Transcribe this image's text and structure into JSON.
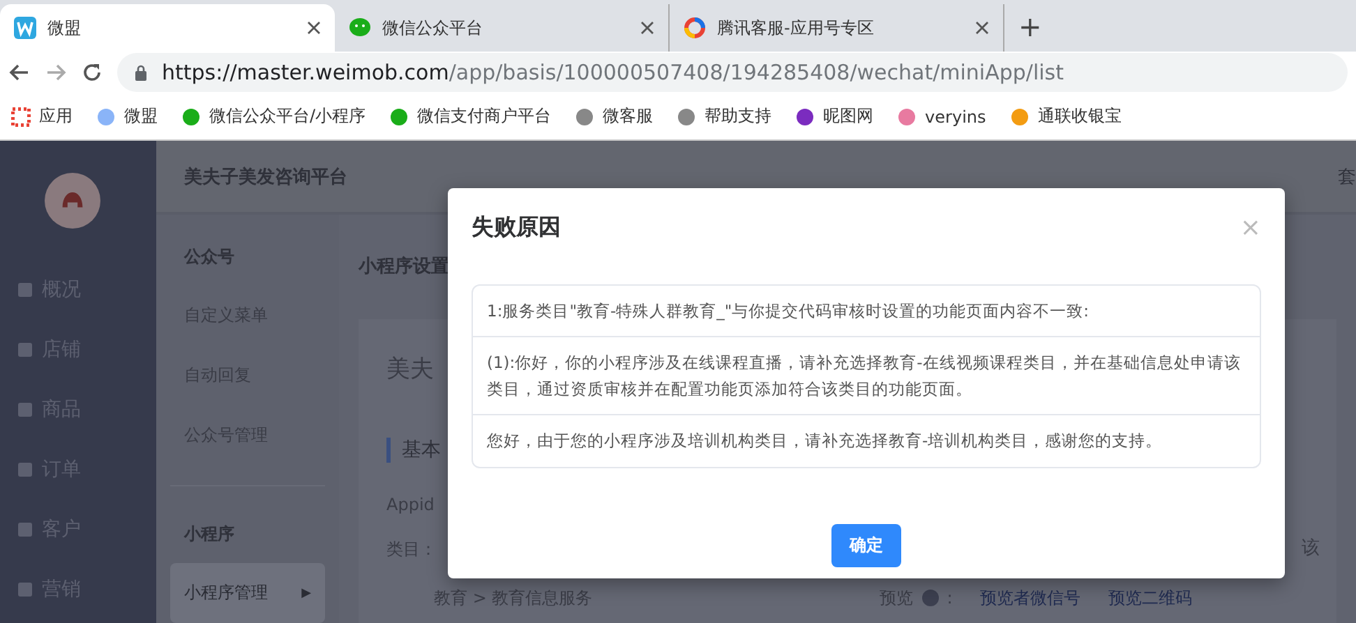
{
  "browser": {
    "tabs": [
      {
        "title": "微盟",
        "selected": true
      },
      {
        "title": "微信公众平台",
        "selected": false
      },
      {
        "title": "腾讯客服-应用号专区",
        "selected": false
      }
    ],
    "new_tab": "+",
    "url": {
      "host": "https://master.weimob.com",
      "path": "/app/basis/100000507408/194285408/wechat/miniApp/list"
    },
    "bookmarks": [
      {
        "label": "应用"
      },
      {
        "label": "微盟"
      },
      {
        "label": "微信公众平台/小程序"
      },
      {
        "label": "微信支付商户平台"
      },
      {
        "label": "微客服"
      },
      {
        "label": "帮助支持"
      },
      {
        "label": "昵图网"
      },
      {
        "label": "veryins"
      },
      {
        "label": "通联收银宝"
      }
    ]
  },
  "sidebar": {
    "items": [
      {
        "label": "概况"
      },
      {
        "label": "店铺"
      },
      {
        "label": "商品"
      },
      {
        "label": "订单"
      },
      {
        "label": "客户"
      },
      {
        "label": "营销"
      }
    ]
  },
  "header": {
    "title": "美夫子美发咨询平台",
    "right": "套"
  },
  "subnav": [
    {
      "kind": "heading",
      "label": "公众号"
    },
    {
      "kind": "item",
      "label": "自定义菜单",
      "selected": false
    },
    {
      "kind": "item",
      "label": "自动回复",
      "selected": false
    },
    {
      "kind": "item",
      "label": "公众号管理",
      "selected": false
    },
    {
      "kind": "heading",
      "label": "小程序"
    },
    {
      "kind": "item",
      "label": "小程序管理",
      "selected": true,
      "arrow": "▶"
    }
  ],
  "main": {
    "page_title": "小程序设置",
    "card_title": "美夫",
    "section_title": "基本",
    "appid_label": "Appid",
    "category_label": "类目：",
    "category_value": "教育 > 教育信息服务",
    "right_fragment": "该",
    "preview_label": "预览",
    "preview_colon": ":",
    "preview_links": [
      "预览者微信号",
      "预览二维码"
    ]
  },
  "dialog": {
    "title": "失败原因",
    "close": "×",
    "messages": [
      "1:服务类目\"教育-特殊人群教育_\"与你提交代码审核时设置的功能页面内容不一致:",
      "(1):你好，你的小程序涉及在线课程直播，请补充选择教育-在线视频课程类目，并在基础信息处申请该类目，通过资质审核并在配置功能页添加符合该类目的功能页面。",
      "您好，由于您的小程序涉及培训机构类目，请补充选择教育-培训机构类目，感谢您的支持。"
    ],
    "confirm": "确定"
  }
}
